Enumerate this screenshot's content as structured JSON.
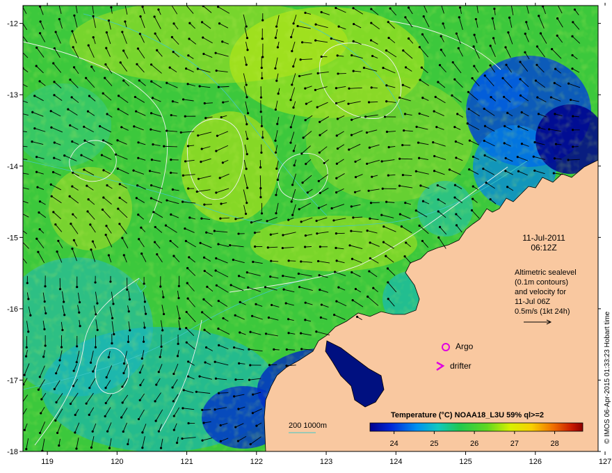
{
  "date_label": "11-Jul-2011",
  "time_label": "06:12Z",
  "altimetry_note": {
    "line1": "Altimetric sealevel",
    "line2": "(0.1m contours)",
    "line3": "and velocity for",
    "line4": "11-Jul 06Z",
    "line5": "0.5m/s (1kt 24h)"
  },
  "legend": {
    "argo_label": "Argo",
    "drifter_label": "drifter",
    "argo_color": "#e000e0",
    "drifter_color": "#e000e0"
  },
  "depth_legend": {
    "label": "200  1000m",
    "color": "#40c8c8"
  },
  "colorbar": {
    "title": "Temperature (°C) NOAA18_L3U 59% ql>=2",
    "ticks": [
      "24",
      "25",
      "26",
      "27",
      "28"
    ],
    "range": [
      23.4,
      28.7
    ]
  },
  "credit": "© IMOS 06-Apr-2015 01:33:23 Hobart time",
  "map_data": {
    "x_ticks": [
      "119",
      "120",
      "121",
      "122",
      "123",
      "124",
      "125",
      "126",
      "127"
    ],
    "y_ticks": [
      "-12",
      "-13",
      "-14",
      "-15",
      "-16",
      "-17",
      "-18"
    ],
    "lon_range": [
      118.65,
      126.9
    ],
    "lat_range": [
      -18.0,
      -11.75
    ],
    "land_color": "#f9c8a0",
    "contour_color": "#f0f0f0",
    "isobath_color": "#40c8c8"
  }
}
